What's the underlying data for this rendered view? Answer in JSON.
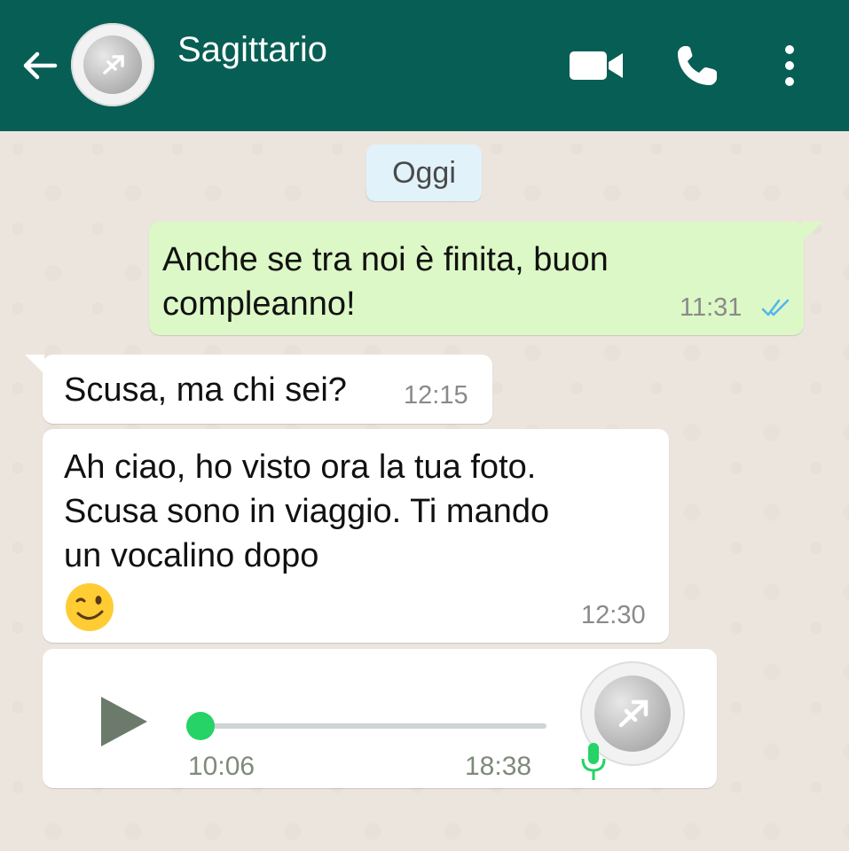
{
  "header": {
    "contact_name": "Sagittario",
    "icons": [
      "back-arrow-icon",
      "video-call-icon",
      "phone-call-icon",
      "more-options-icon"
    ],
    "color": "#075e54"
  },
  "chat": {
    "date_chip": "Oggi",
    "messages": [
      {
        "direction": "outgoing",
        "text": "Anche se tra noi è finita, buon compleanno!",
        "time": "11:31",
        "status": "read"
      },
      {
        "direction": "incoming",
        "text": "Scusa, ma chi sei?",
        "time": "12:15"
      },
      {
        "direction": "incoming",
        "text": "Ah ciao, ho visto ora la tua foto. Scusa sono in viaggio. Ti mando un vocalino dopo",
        "emoji": "😉",
        "time": "12:30"
      }
    ],
    "voice_message": {
      "position": "10:06",
      "duration": "18:38",
      "progress_fraction": 0.0,
      "accent": "#25d366"
    }
  }
}
